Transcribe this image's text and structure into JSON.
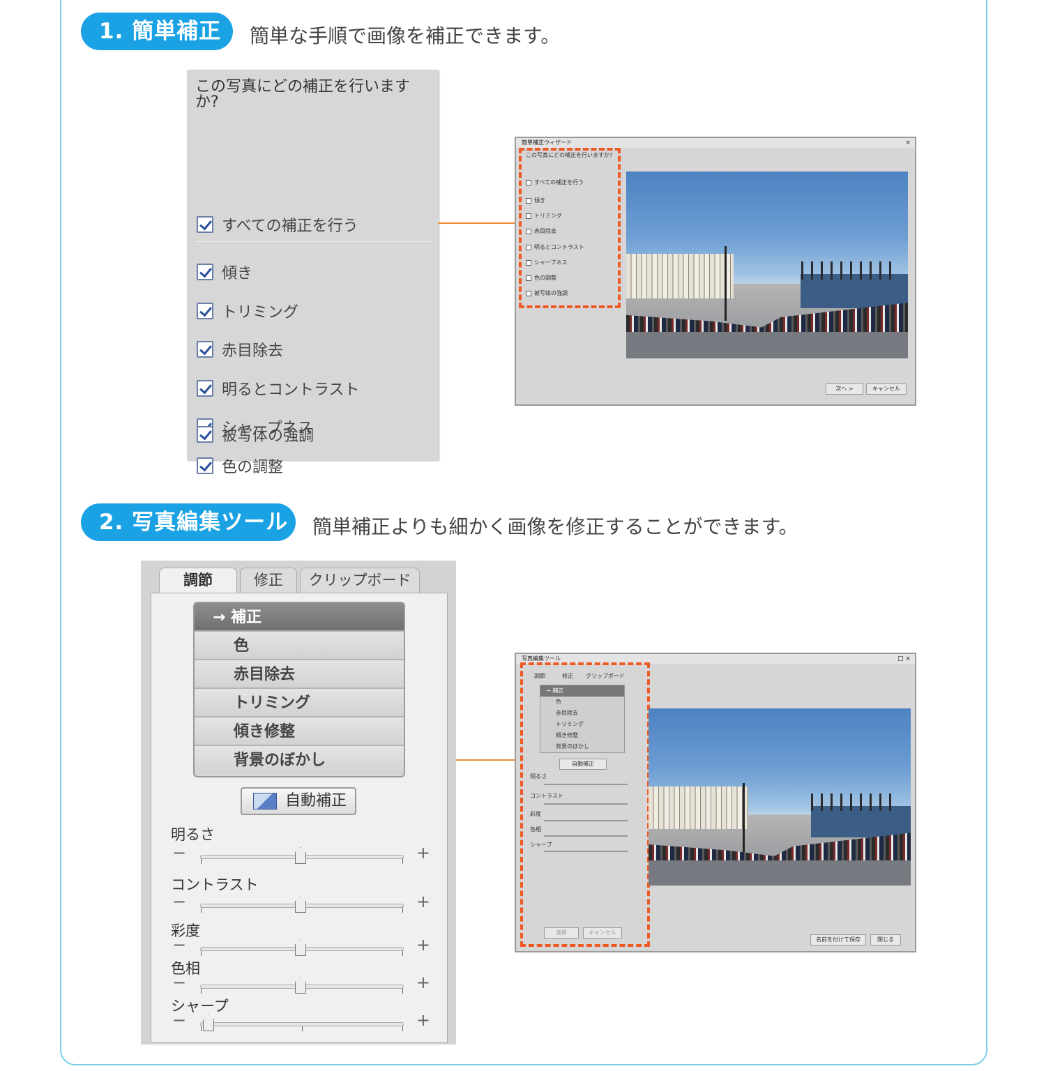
{
  "section1": {
    "badge": "1. 簡単補正",
    "description": "簡単な手順で画像を補正できます。",
    "wizard": {
      "question": "この写真にどの補正を行いますか?",
      "all_label": "すべての補正を行う",
      "items": [
        "傾き",
        "トリミング",
        "赤目除去",
        "明るとコントラスト",
        "シャープネス",
        "色の調整",
        "被写体の強調"
      ]
    },
    "screenshot": {
      "title": "簡単補正ウィザード",
      "question": "この写真にどの補正を行いますか?",
      "all_label": "すべての補正を行う",
      "items": [
        "傾き",
        "トリミング",
        "赤目除去",
        "明るとコントラスト",
        "シャープネス",
        "色の調整",
        "被写体の強調"
      ],
      "next_button": "次へ >",
      "cancel_button": "キャンセル"
    }
  },
  "section2": {
    "badge": "2. 写真編集ツール",
    "description": "簡単補正よりも細かく画像を修正することができます。",
    "tool": {
      "tabs": [
        "調節",
        "修正",
        "クリップボード"
      ],
      "menu": [
        "→ 補正",
        "色",
        "赤目除去",
        "トリミング",
        "傾き修整",
        "背景のぼかし"
      ],
      "auto_button": "自動補正",
      "sliders": [
        {
          "label": "明るさ",
          "level": 0.5
        },
        {
          "label": "コントラスト",
          "level": 0.5
        },
        {
          "label": "彩度",
          "level": 0.5
        },
        {
          "label": "色相",
          "level": 0.5
        },
        {
          "label": "シャープ",
          "level": 0.0
        }
      ],
      "minus": "−",
      "plus": "+"
    },
    "screenshot": {
      "title": "写真編集ツール",
      "tabs": [
        "調節",
        "修正",
        "クリップボード"
      ],
      "menu": [
        "→ 補正",
        "色",
        "赤目除去",
        "トリミング",
        "傾き修整",
        "背景のぼかし"
      ],
      "auto_button": "自動補正",
      "sliders": [
        "明るさ",
        "コントラスト",
        "彩度",
        "色相",
        "シャープ"
      ],
      "apply_button": "適用",
      "cancel_button": "キャンセル",
      "save_button": "名前を付けて保存",
      "close_button": "閉じる"
    }
  },
  "colors": {
    "accent": "#1aa2e4",
    "highlight": "#ef5a24",
    "connector": "#f08a30",
    "frame": "#7ccfe6"
  }
}
